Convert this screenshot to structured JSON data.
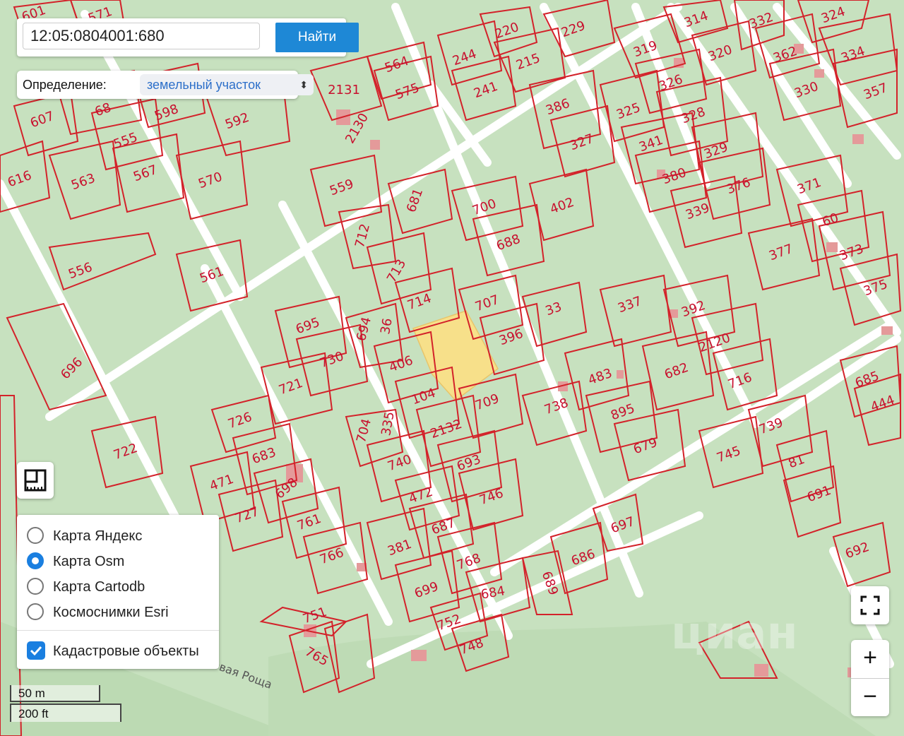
{
  "search": {
    "value": "12:05:0804001:680",
    "button_label": "Найти"
  },
  "definition": {
    "label": "Определение:",
    "selected": "земельный участок"
  },
  "layers": {
    "options": [
      {
        "label": "Карта Яндекс",
        "selected": false
      },
      {
        "label": "Карта Osm",
        "selected": true
      },
      {
        "label": "Карта Cartodb",
        "selected": false
      },
      {
        "label": "Космоснимки Esri",
        "selected": false
      }
    ],
    "cadastral": {
      "label": "Кадастровые объекты",
      "checked": true
    }
  },
  "scale": {
    "metric": "50 m",
    "imperial": "200 ft"
  },
  "zoom": {
    "in": "+",
    "out": "−"
  },
  "map_labels": {
    "street": "овая Роща",
    "watermark": "циан"
  },
  "colors": {
    "map_bg": "#c7e1bf",
    "road": "#ffffff",
    "parcel_line": "#d3222a",
    "highlight": "#f7e08a",
    "building": "#e49a9a",
    "accent": "#1e88d6"
  },
  "icons": {
    "ruler": "ruler-icon",
    "fullscreen": "fullscreen-icon"
  },
  "parcels": [
    "601",
    "571",
    "314",
    "332",
    "324",
    "220",
    "229",
    "319",
    "244",
    "215",
    "564",
    "2131",
    "575",
    "320",
    "362",
    "334",
    "326",
    "68",
    "598",
    "241",
    "330",
    "357",
    "607",
    "592",
    "2130",
    "386",
    "325",
    "328",
    "555",
    "327",
    "567",
    "616",
    "563",
    "570",
    "341",
    "329",
    "380",
    "559",
    "681",
    "376",
    "371",
    "700",
    "402",
    "60",
    "712",
    "339",
    "688",
    "556",
    "377",
    "373",
    "561",
    "713",
    "375",
    "714",
    "707",
    "33",
    "337",
    "392",
    "695",
    "694",
    "36",
    "396",
    "2120",
    "696",
    "730",
    "721",
    "406",
    "682",
    "483",
    "685",
    "104",
    "716",
    "444",
    "709",
    "738",
    "726",
    "704",
    "335",
    "895",
    "739",
    "722",
    "683",
    "2132",
    "679",
    "745",
    "740",
    "471",
    "698",
    "81",
    "693",
    "472",
    "746",
    "691",
    "727",
    "761",
    "687",
    "697",
    "381",
    "766",
    "692",
    "686",
    "768",
    "699",
    "689",
    "684",
    "751",
    "752",
    "748",
    "765"
  ]
}
